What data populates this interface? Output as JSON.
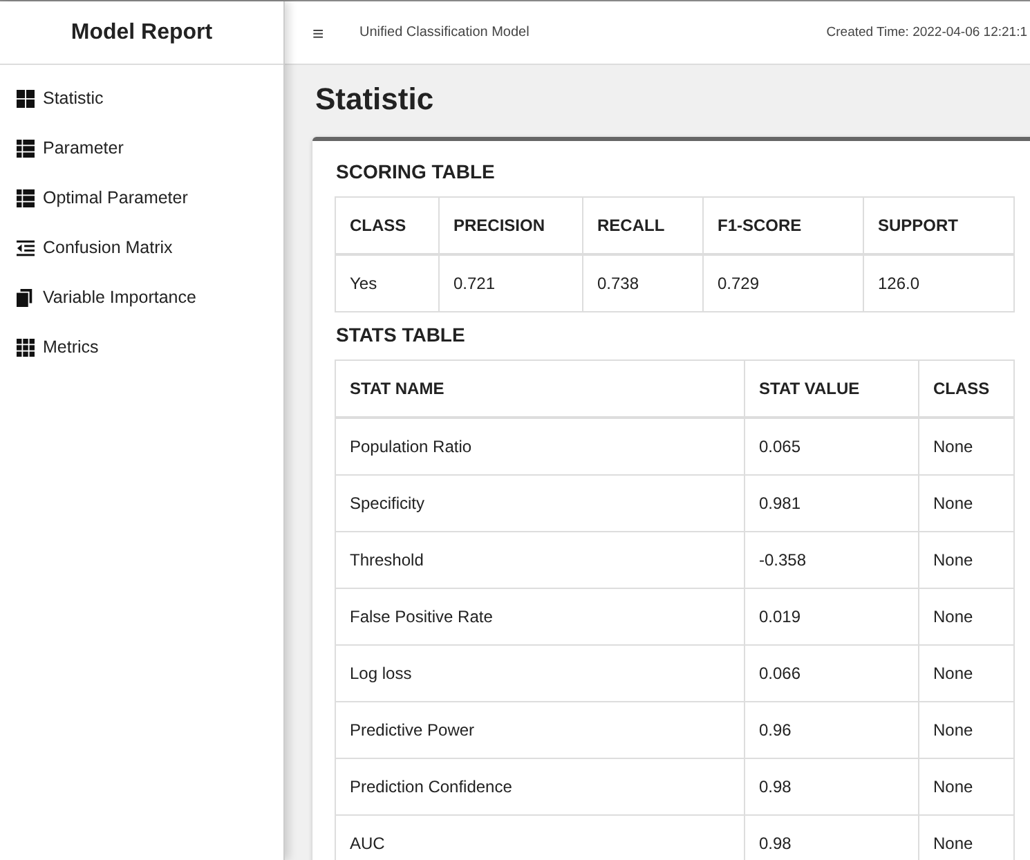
{
  "sidebar": {
    "title": "Model Report",
    "items": [
      {
        "label": "Statistic"
      },
      {
        "label": "Parameter"
      },
      {
        "label": "Optimal Parameter"
      },
      {
        "label": "Confusion Matrix"
      },
      {
        "label": "Variable Importance"
      },
      {
        "label": "Metrics"
      }
    ]
  },
  "header": {
    "menu": "≡",
    "model_name": "Unified Classification Model",
    "created": "Created Time: 2022-04-06 12:21:1"
  },
  "page_title": "Statistic",
  "scoring_table": {
    "title": "SCORING TABLE",
    "columns": [
      "CLASS",
      "PRECISION",
      "RECALL",
      "F1-SCORE",
      "SUPPORT"
    ],
    "rows": [
      [
        "Yes",
        "0.721",
        "0.738",
        "0.729",
        "126.0"
      ]
    ]
  },
  "stats_table": {
    "title": "STATS TABLE",
    "columns": [
      "STAT NAME",
      "STAT VALUE",
      "CLASS"
    ],
    "rows": [
      [
        "Population Ratio",
        "0.065",
        "None"
      ],
      [
        "Specificity",
        "0.981",
        "None"
      ],
      [
        "Threshold",
        "-0.358",
        "None"
      ],
      [
        "False Positive Rate",
        "0.019",
        "None"
      ],
      [
        "Log loss",
        "0.066",
        "None"
      ],
      [
        "Predictive Power",
        "0.96",
        "None"
      ],
      [
        "Prediction Confidence",
        "0.98",
        "None"
      ],
      [
        "AUC",
        "0.98",
        "None"
      ]
    ]
  }
}
